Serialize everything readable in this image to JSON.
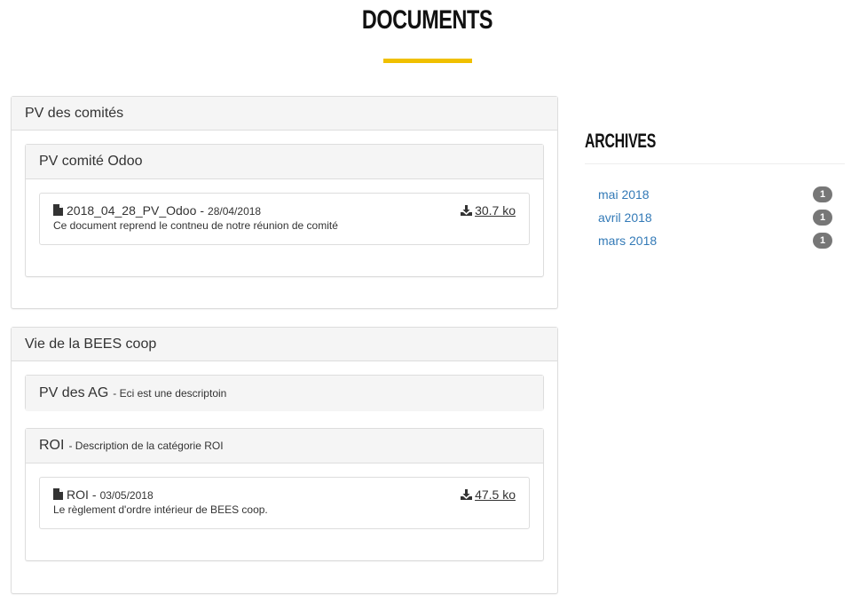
{
  "page": {
    "title": "DOCUMENTS"
  },
  "categories": [
    {
      "title": "PV des comités",
      "subcategories": [
        {
          "title": "PV comité Odoo",
          "description": "",
          "documents": [
            {
              "name": "2018_04_28_PV_Odoo",
              "sep": "-",
              "date": "28/04/2018",
              "description": "Ce document reprend le contneu de notre réunion de comité",
              "size": "30.7 ko"
            }
          ]
        }
      ]
    },
    {
      "title": "Vie de la BEES coop",
      "subcategories": [
        {
          "title": "PV des AG",
          "description": "- Eci est une descriptoin",
          "documents": []
        },
        {
          "title": "ROI",
          "description": "- Description de la catégorie ROI",
          "documents": [
            {
              "name": "ROI",
              "sep": "-",
              "date": "03/05/2018",
              "description": "Le règlement d'ordre intérieur de BEES coop.",
              "size": "47.5 ko"
            }
          ]
        }
      ]
    }
  ],
  "archives": {
    "title": "ARCHIVES",
    "items": [
      {
        "label": "mai 2018",
        "count": "1"
      },
      {
        "label": "avril 2018",
        "count": "1"
      },
      {
        "label": "mars 2018",
        "count": "1"
      }
    ]
  },
  "colors": {
    "accent": "#f0c000",
    "link": "#337ab7",
    "badge": "#777777"
  },
  "icons": {
    "document": "file-icon",
    "download": "download-icon"
  }
}
